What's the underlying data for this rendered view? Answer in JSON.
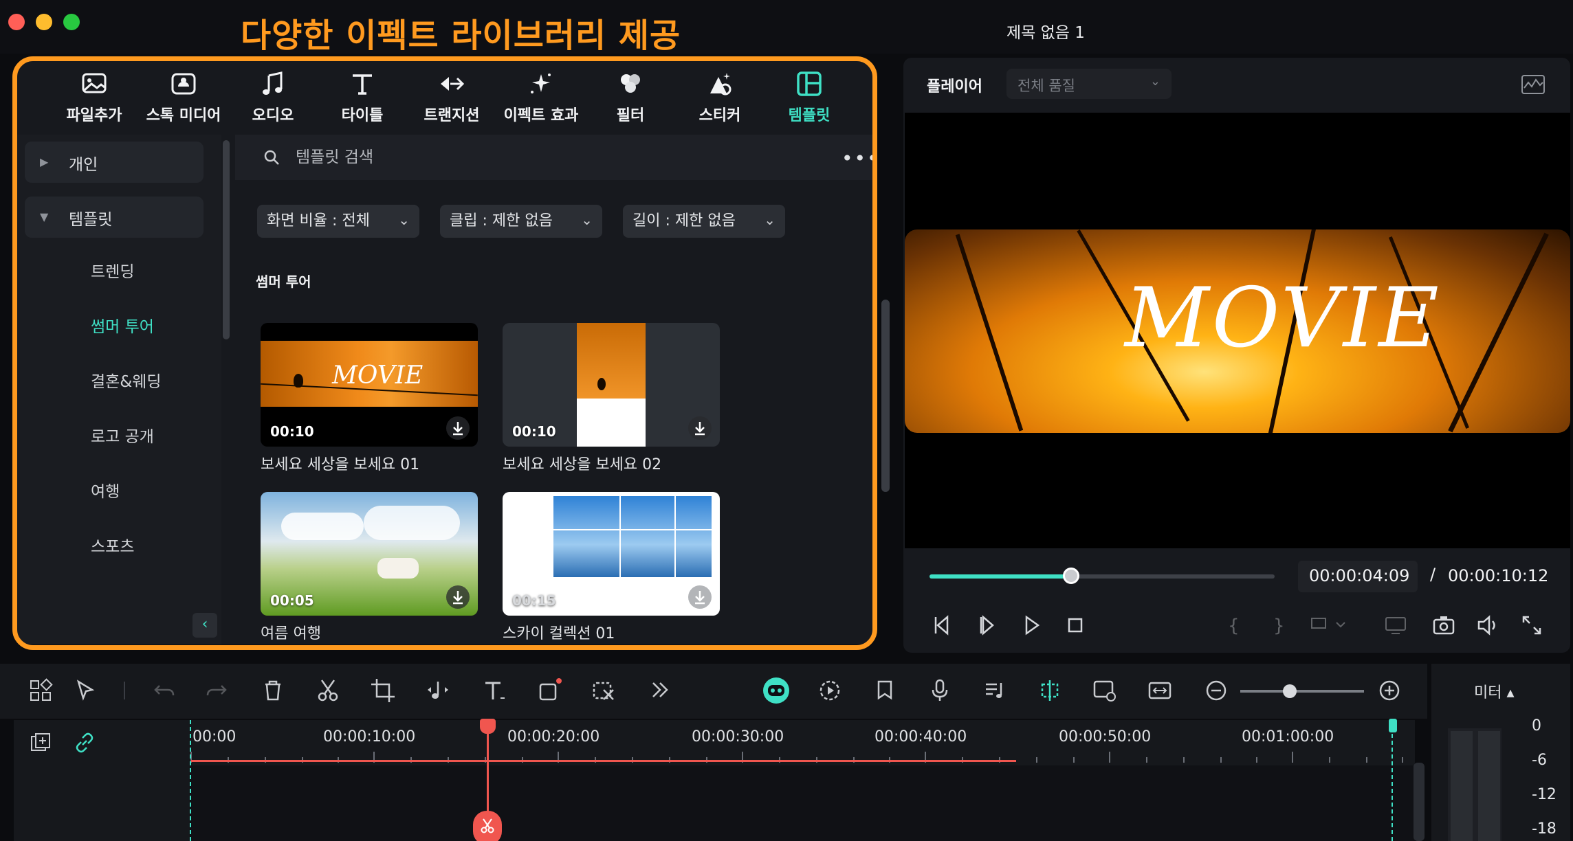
{
  "window": {
    "annotation": "다양한 이펙트 라이브러리 제공",
    "title": "제목 없음 1"
  },
  "tabs": [
    {
      "label": "파일추가",
      "icon": "import-media-icon"
    },
    {
      "label": "스톡 미디어",
      "icon": "stock-media-icon"
    },
    {
      "label": "오디오",
      "icon": "audio-note-icon"
    },
    {
      "label": "타이틀",
      "icon": "title-text-icon"
    },
    {
      "label": "트랜지션",
      "icon": "transition-icon"
    },
    {
      "label": "이펙트 효과",
      "icon": "effects-sparkle-icon"
    },
    {
      "label": "필터",
      "icon": "filter-icon"
    },
    {
      "label": "스티커",
      "icon": "sticker-icon"
    },
    {
      "label": "템플릿",
      "icon": "template-icon",
      "active": true
    }
  ],
  "sidebar": {
    "categories": [
      {
        "label": "개인",
        "expanded": false
      },
      {
        "label": "템플릿",
        "expanded": true
      }
    ],
    "items": [
      {
        "label": "트렌딩"
      },
      {
        "label": "썸머 투어",
        "active": true
      },
      {
        "label": "결혼&웨딩"
      },
      {
        "label": "로고 공개"
      },
      {
        "label": "여행"
      },
      {
        "label": "스포츠"
      }
    ]
  },
  "search": {
    "placeholder": "템플릿 검색",
    "value": ""
  },
  "filters": [
    {
      "label": "화면 비율 : 전체"
    },
    {
      "label": "클립 : 제한 없음"
    },
    {
      "label": "길이 : 제한 없음"
    }
  ],
  "section_title": "썸머 투어",
  "templates": [
    {
      "title": "보세요 세상을 보세요 01",
      "duration": "00:10",
      "thumb_text": "MOVIE"
    },
    {
      "title": "보세요 세상을 보세요 02",
      "duration": "00:10"
    },
    {
      "title": "여름 여행",
      "duration": "00:05"
    },
    {
      "title": "스카이 컬렉션 01",
      "duration": "00:15"
    }
  ],
  "player": {
    "label": "플레이어",
    "quality": "전체 품질",
    "preview_text": "MOVIE",
    "time_current": "00:00:04:09",
    "time_separator": "/",
    "time_total": "00:00:10:12",
    "progress": 0.41
  },
  "timeline": {
    "ruler": [
      "00:00",
      "00:00:10:00",
      "00:00:20:00",
      "00:00:30:00",
      "00:00:40:00",
      "00:00:50:00",
      "00:01:00:00"
    ],
    "zoom": 0.4
  },
  "meter": {
    "label": "미터 ▴",
    "ticks": [
      "0",
      "-6",
      "-12",
      "-18"
    ]
  },
  "colors": {
    "accent": "#3fe0c5",
    "annotation": "#ff9a1f",
    "playhead": "#f0564f"
  }
}
